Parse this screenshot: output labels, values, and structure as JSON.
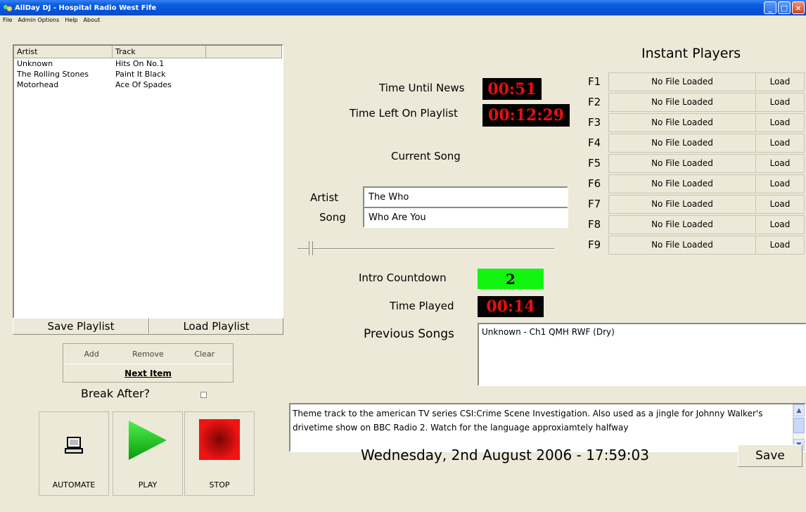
{
  "window": {
    "title": "AllDay DJ - Hospital Radio West Fife"
  },
  "menu": [
    "File",
    "Admin Options",
    "Help",
    "About"
  ],
  "playlist": {
    "columns": [
      "Artist",
      "Track"
    ],
    "rows": [
      {
        "artist": "Unknown",
        "track": "Hits On No.1"
      },
      {
        "artist": "The Rolling Stones",
        "track": "Paint It Black"
      },
      {
        "artist": "Motorhead",
        "track": "Ace Of Spades"
      }
    ],
    "save_label": "Save Playlist",
    "load_label": "Load Playlist"
  },
  "edit": {
    "add": "Add",
    "remove": "Remove",
    "clear": "Clear",
    "next": "Next Item"
  },
  "break_after": {
    "label": "Break After?",
    "checked": false
  },
  "controls": {
    "automate": "AUTOMATE",
    "play": "PLAY",
    "stop": "STOP"
  },
  "timers": {
    "news_label": "Time Until News",
    "news_value": "00:51",
    "playlist_label": "Time Left On Playlist",
    "playlist_value": "00:12:29",
    "intro_label": "Intro Countdown",
    "intro_value": "2",
    "played_label": "Time Played",
    "played_value": "00:14"
  },
  "current": {
    "heading": "Current Song",
    "artist_label": "Artist",
    "artist_value": "The Who",
    "song_label": "Song",
    "song_value": "Who Are You"
  },
  "previous": {
    "label": "Previous Songs",
    "items": "Unknown - Ch1 QMH RWF (Dry)"
  },
  "notes": "Theme track to the american TV series CSI:Crime Scene Investigation. Also used as a jingle for Johnny Walker's drivetime show on BBC Radio 2. Watch for the language approxiamtely halfway",
  "datetime": "Wednesday, 2nd August 2006 - 17:59:03",
  "save_label": "Save",
  "instant": {
    "title": "Instant Players",
    "players": [
      {
        "key": "F1",
        "file": "No File Loaded",
        "load": "Load"
      },
      {
        "key": "F2",
        "file": "No File Loaded",
        "load": "Load"
      },
      {
        "key": "F3",
        "file": "No File Loaded",
        "load": "Load"
      },
      {
        "key": "F4",
        "file": "No File Loaded",
        "load": "Load"
      },
      {
        "key": "F5",
        "file": "No File Loaded",
        "load": "Load"
      },
      {
        "key": "F6",
        "file": "No File Loaded",
        "load": "Load"
      },
      {
        "key": "F7",
        "file": "No File Loaded",
        "load": "Load"
      },
      {
        "key": "F8",
        "file": "No File Loaded",
        "load": "Load"
      },
      {
        "key": "F9",
        "file": "No File Loaded",
        "load": "Load"
      }
    ]
  },
  "colors": {
    "led_bg": "#000000",
    "led_text": "#ee0d0d",
    "intro_bg": "#11f511",
    "play": "#18c618",
    "stop": "#e01010"
  }
}
